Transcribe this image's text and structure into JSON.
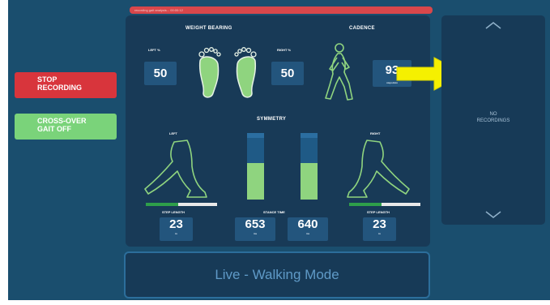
{
  "banner": {
    "text": "recording gait analysis... 00:00:12"
  },
  "left_buttons": {
    "stop_label": "STOP\nRECORDING",
    "crossover_label": "CROSS-OVER\nGAIT OFF"
  },
  "weight_bearing": {
    "title": "WEIGHT BEARING",
    "left_label": "LEFT %",
    "left_value": "50",
    "right_label": "RIGHT %",
    "right_value": "50"
  },
  "cadence": {
    "title": "CADENCE",
    "value": "93",
    "unit": "steps/min"
  },
  "symmetry": {
    "title": "SYMMETRY",
    "left_label": "LEFT",
    "right_label": "RIGHT",
    "left_bar_fill": 0.55,
    "right_bar_fill": 0.55,
    "left_step_progress": 0.45,
    "right_step_progress": 0.45
  },
  "step_length": {
    "left_label": "STEP LENGTH",
    "left_value": "23",
    "left_unit": "in",
    "right_label": "STEP LENGTH",
    "right_value": "23",
    "right_unit": "in"
  },
  "stance_time": {
    "label": "STANCE TIME",
    "left_value": "653",
    "left_unit": "ms",
    "right_value": "640",
    "right_unit": "ms"
  },
  "mode": {
    "text": "Live - Walking Mode"
  },
  "recordings": {
    "empty_text": "NO\nRECORDINGS"
  },
  "colors": {
    "background": "#1a4e6e",
    "panel": "#183a57",
    "stop": "#d8353c",
    "crossover": "#7ad37a",
    "foot_fill": "#8fd47f",
    "arrow": "#f5f000"
  }
}
